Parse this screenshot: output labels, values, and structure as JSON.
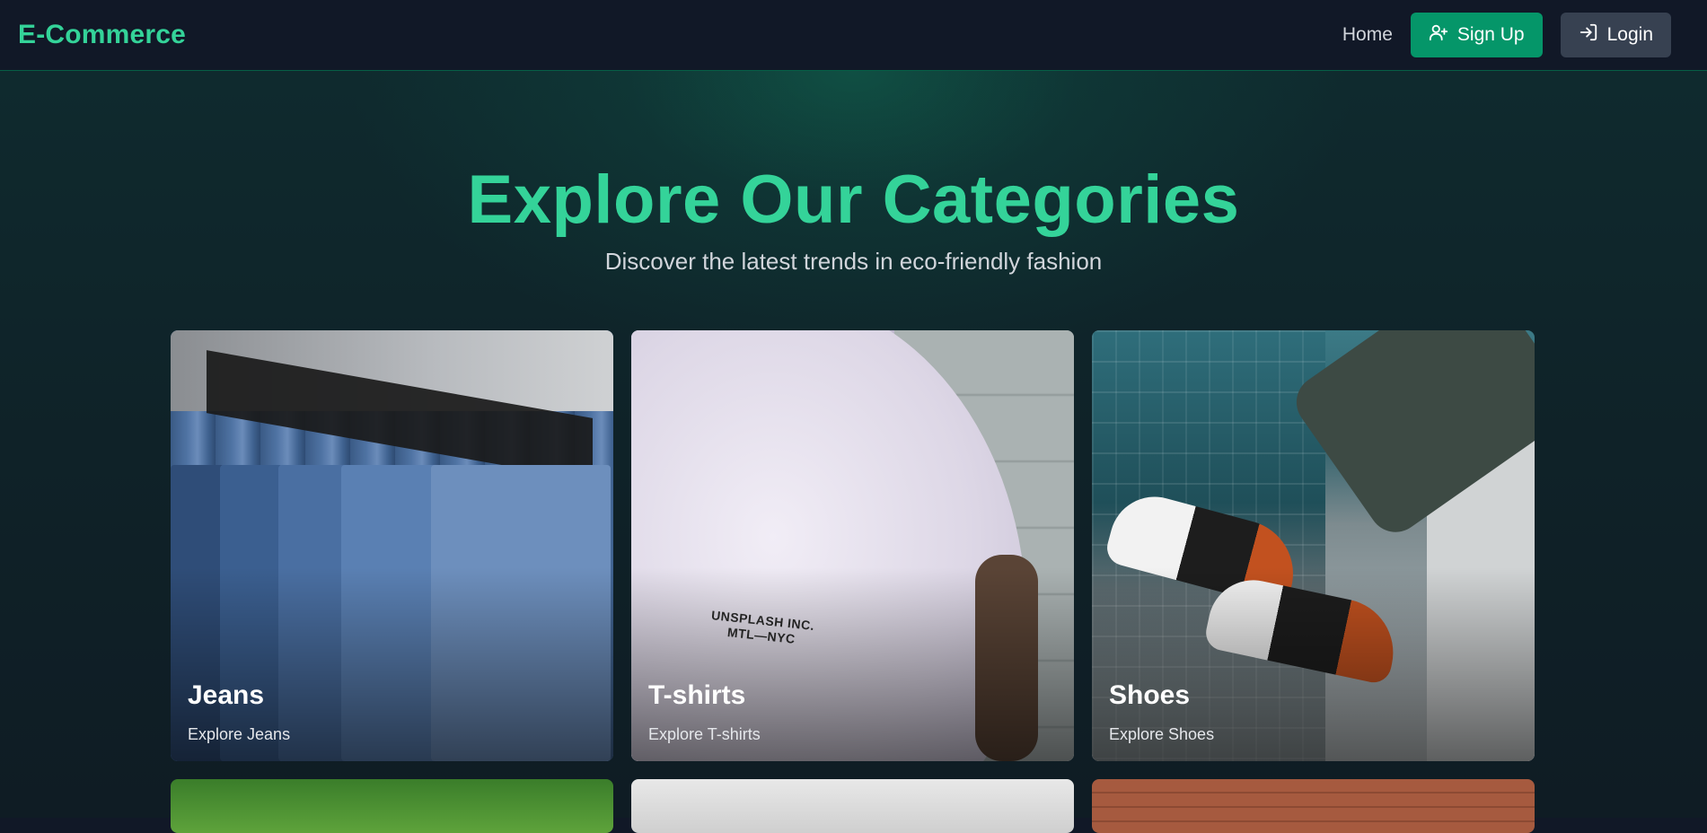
{
  "nav": {
    "brand": "E-Commerce",
    "home": "Home",
    "signup": "Sign Up",
    "login": "Login"
  },
  "hero": {
    "title": "Explore Our Categories",
    "subtitle": "Discover the latest trends in eco-friendly fashion"
  },
  "categories": [
    {
      "title": "Jeans",
      "subtitle": "Explore Jeans"
    },
    {
      "title": "T-shirts",
      "subtitle": "Explore T-shirts",
      "print": "UNSPLASH INC.\nMTL—NYC"
    },
    {
      "title": "Shoes",
      "subtitle": "Explore Shoes"
    }
  ],
  "colors": {
    "accent": "#34d399",
    "signup_bg": "#059669",
    "login_bg": "#374151",
    "background": "#111827"
  }
}
